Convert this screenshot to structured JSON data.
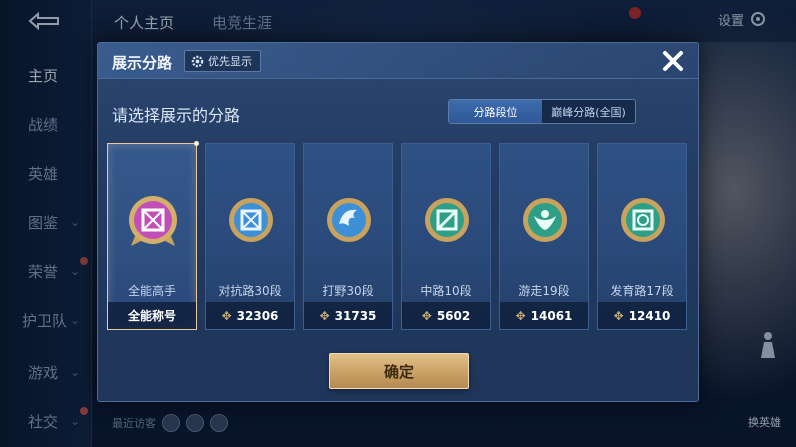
{
  "background": {
    "sidebar": {
      "items": [
        {
          "label": "主页",
          "active": true
        },
        {
          "label": "战绩"
        },
        {
          "label": "英雄"
        },
        {
          "label": "图鉴"
        },
        {
          "label": "荣誉"
        },
        {
          "label": "护卫队"
        },
        {
          "label": "游戏"
        },
        {
          "label": "社交"
        }
      ]
    },
    "tabs": [
      {
        "label": "个人主页",
        "active": true
      },
      {
        "label": "电竞生涯"
      }
    ],
    "settings_label": "设置",
    "bottom": {
      "visitors_label": "最近访客",
      "switch_hero_label": "换英雄"
    }
  },
  "dialog": {
    "title": "展示分路",
    "priority_label": "优先显示",
    "prompt": "请选择展示的分路",
    "segments": [
      {
        "label": "分路段位",
        "active": true
      },
      {
        "label": "巅峰分路(全国)",
        "active": false
      }
    ],
    "cards": [
      {
        "label": "全能高手",
        "stat": "全能称号",
        "icon": "all-round-emblem-icon",
        "selected": true,
        "color": "#c24fb7"
      },
      {
        "label": "对抗路30段",
        "stat": "32306",
        "icon": "clash-lane-emblem-icon",
        "color": "#3d8fd6"
      },
      {
        "label": "打野30段",
        "stat": "31735",
        "icon": "jungle-emblem-icon",
        "color": "#3d8fd6"
      },
      {
        "label": "中路10段",
        "stat": "5602",
        "icon": "mid-lane-emblem-icon",
        "color": "#2f9e86"
      },
      {
        "label": "游走19段",
        "stat": "14061",
        "icon": "roam-emblem-icon",
        "color": "#2f9e86"
      },
      {
        "label": "发育路17段",
        "stat": "12410",
        "icon": "farm-lane-emblem-icon",
        "color": "#2f9e86"
      }
    ],
    "confirm_label": "确定"
  }
}
